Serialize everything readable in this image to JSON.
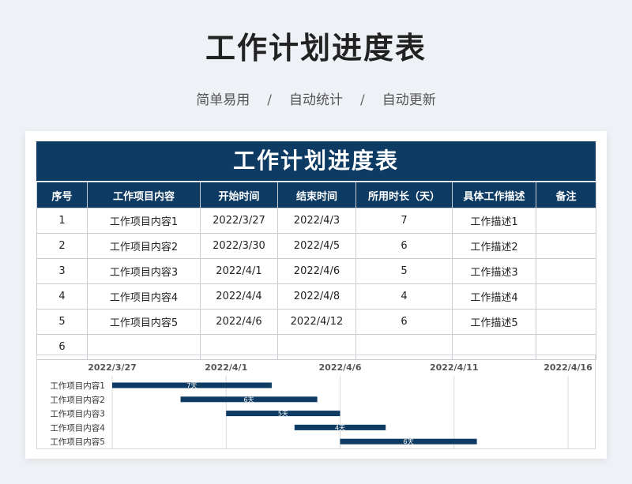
{
  "header": {
    "title": "工作计划进度表",
    "subtitle_items": [
      "简单易用",
      "自动统计",
      "自动更新"
    ],
    "separator": "/"
  },
  "sheet": {
    "title": "工作计划进度表",
    "columns": [
      "序号",
      "工作项目内容",
      "开始时间",
      "结束时间",
      "所用时长（天）",
      "具体工作描述",
      "备注"
    ],
    "rows": [
      [
        "1",
        "工作项目内容1",
        "2022/3/27",
        "2022/4/3",
        "7",
        "工作描述1",
        ""
      ],
      [
        "2",
        "工作项目内容2",
        "2022/3/30",
        "2022/4/5",
        "6",
        "工作描述2",
        ""
      ],
      [
        "3",
        "工作项目内容3",
        "2022/4/1",
        "2022/4/6",
        "5",
        "工作描述3",
        ""
      ],
      [
        "4",
        "工作项目内容4",
        "2022/4/4",
        "2022/4/8",
        "4",
        "工作描述4",
        ""
      ],
      [
        "5",
        "工作项目内容5",
        "2022/4/6",
        "2022/4/12",
        "6",
        "工作描述5",
        ""
      ],
      [
        "6",
        "",
        "",
        "",
        "",
        "",
        ""
      ]
    ]
  },
  "chart_data": {
    "type": "bar",
    "orientation": "horizontal",
    "categories": [
      "工作项目内容1",
      "工作项目内容2",
      "工作项目内容3",
      "工作项目内容4",
      "工作项目内容5"
    ],
    "start": [
      "2022/3/27",
      "2022/3/30",
      "2022/4/1",
      "2022/4/4",
      "2022/4/6"
    ],
    "end": [
      "2022/4/3",
      "2022/4/5",
      "2022/4/6",
      "2022/4/8",
      "2022/4/12"
    ],
    "bar_labels": [
      "7天",
      "6天",
      "5天",
      "4天",
      "6天"
    ],
    "x_tick_labels": [
      "2022/3/27",
      "2022/4/1",
      "2022/4/6",
      "2022/4/11",
      "2022/4/16"
    ],
    "xlim": [
      "2022/3/27",
      "2022/4/16"
    ],
    "grid": true,
    "bar_color": "#0e3b63"
  },
  "colors": {
    "header_bg": "#0e3b63",
    "border": "#c9cdd2",
    "page_bg": "#eef1f5"
  }
}
